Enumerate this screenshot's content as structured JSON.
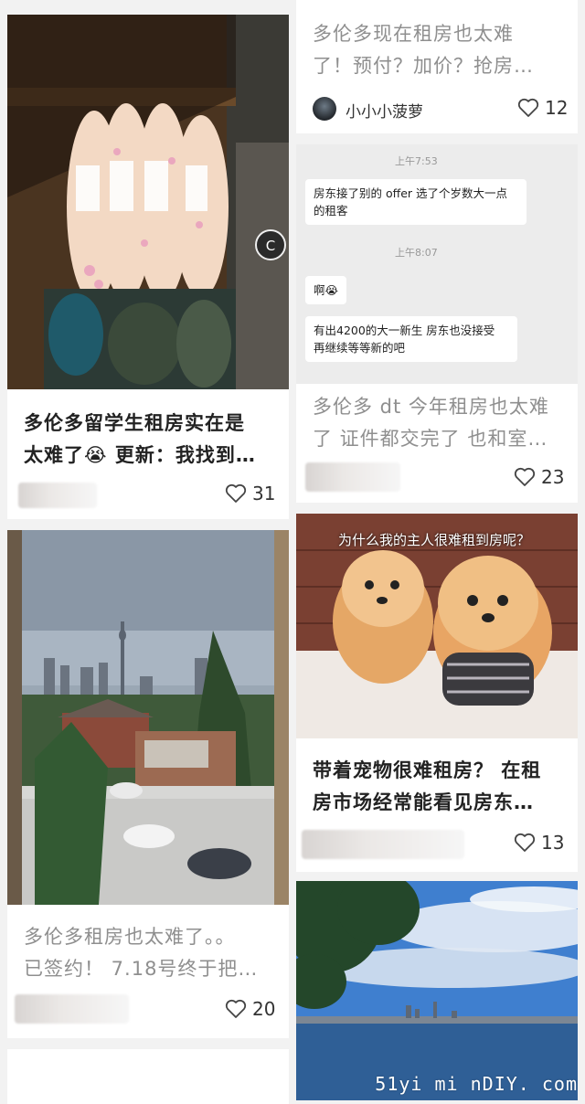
{
  "feed": {
    "card1": {
      "title_line1": "多伦多留学生租房实在是",
      "title_line2": "太难了😭 更新：我找到…",
      "likes": "31"
    },
    "card2": {
      "title_line1": "多伦多现在租房也太难",
      "title_line2": "了！预付？加价？抢房…",
      "username": "小小小菠萝",
      "likes": "12"
    },
    "card3": {
      "chat": {
        "time1": "上午7:53",
        "msg1": "房东接了别的 offer 选了个岁数大一点的租客",
        "time2": "上午8:07",
        "msg2": "啊😭",
        "msg3": "有出4200的大一新生 房东也没接受 再继续等等新的吧"
      },
      "title_line1": "多伦多 dt 今年租房也太难",
      "title_line2": "了 证件都交完了 也和室…",
      "likes": "23"
    },
    "card4": {
      "title_line1": "多伦多租房也太难了。。",
      "title_line2": "已签约！ 7.18号终于把…",
      "likes": "20"
    },
    "card5": {
      "image_caption": "为什么我的主人很难租到房呢？",
      "title_line1": "带着宠物很难租房？ 在租",
      "title_line2": "房市场经常能看见房东…",
      "likes": "13"
    },
    "badge_letter": "C",
    "watermark": "51yi mi nDIY. com"
  }
}
